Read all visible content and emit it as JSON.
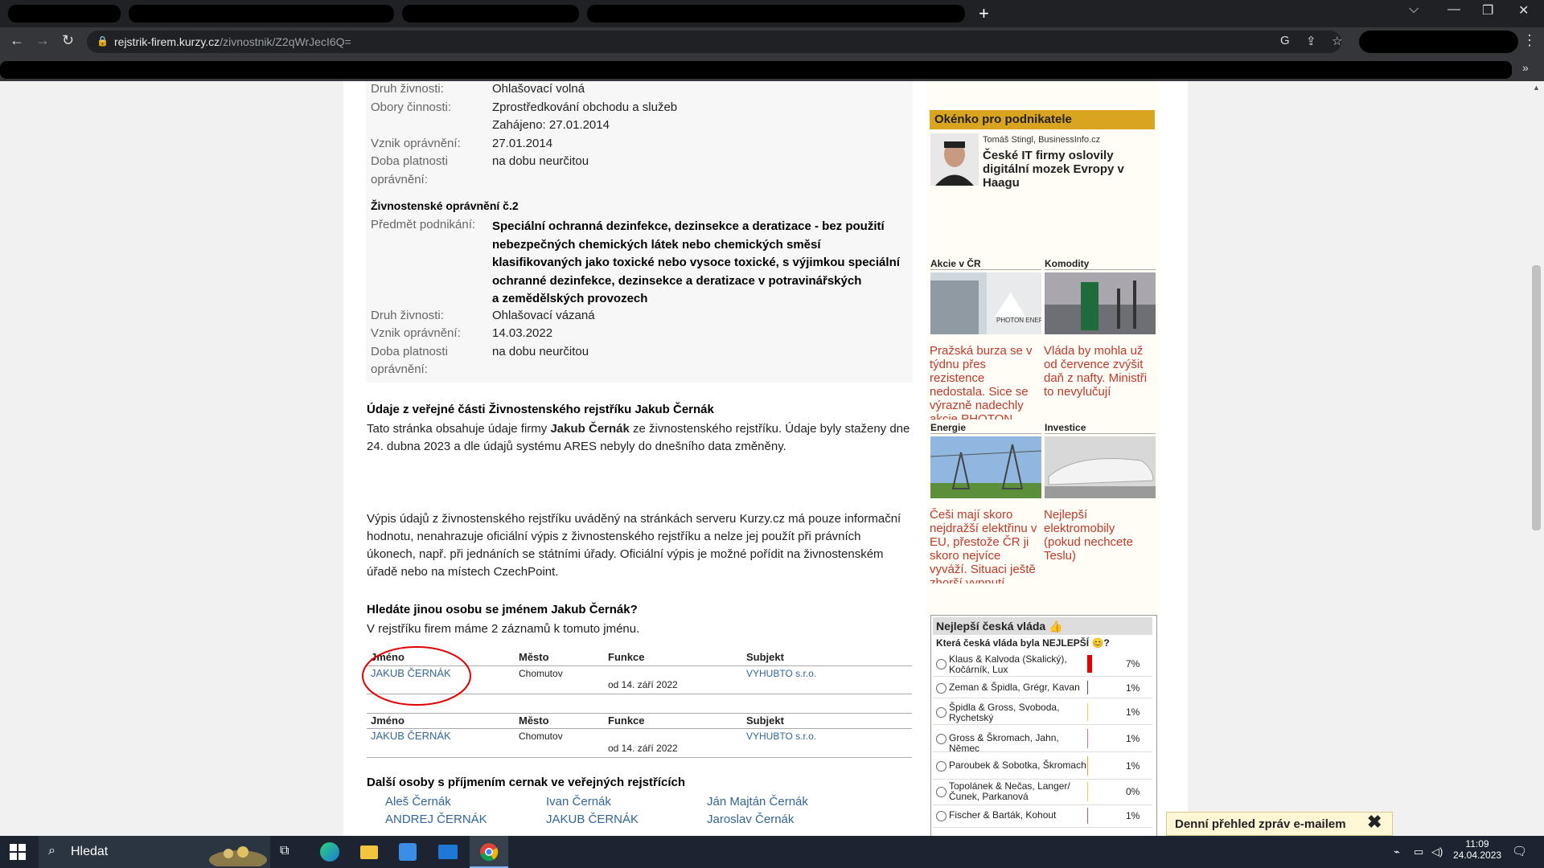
{
  "browser": {
    "url_domain": "rejstrik-firem.kurzy.cz",
    "url_path": "/zivnostnik/Z2qWrJecI6Q=",
    "new_tab_symbol": "+",
    "minimize": "⌵",
    "win_min": "—",
    "win_max": "❐",
    "win_close": "✕",
    "back": "←",
    "forward": "→",
    "reload": "↻",
    "menu": "⋮",
    "extensions": "»"
  },
  "permit1": {
    "druh_label": "Druh živnosti:",
    "druh_value": "Ohlašovací volná",
    "obory_label": "Obory činnosti:",
    "obory_value": "Zprostředkování obchodu a služeb",
    "zahajeno": "Zahájeno: 27.01.2014",
    "vznik_label": "Vznik oprávnění:",
    "vznik_value": "27.01.2014",
    "doba_label1": "Doba platnosti",
    "doba_label2": "oprávnění:",
    "doba_value": "na dobu neurčitou"
  },
  "permit2": {
    "title": "Živnostenské oprávnění č.2",
    "predmet_label": "Předmět podnikání:",
    "predmet_lines": [
      "Speciální ochranná dezinfekce, dezinsekce a deratizace - bez použití",
      "nebezpečných chemických látek nebo chemických směsí",
      "klasifikovaných jako toxické nebo vysoce toxické, s výjimkou speciální",
      "ochranné dezinfekce, dezinsekce a deratizace v potravinářských",
      "a zemědělských provozech"
    ],
    "druh_label": "Druh živnosti:",
    "druh_value": "Ohlašovací vázaná",
    "vznik_label": "Vznik oprávnění:",
    "vznik_value": "14.03.2022",
    "doba_label1": "Doba platnosti",
    "doba_label2": "oprávnění:",
    "doba_value": "na dobu neurčitou"
  },
  "public": {
    "title": "Údaje z veřejné části Živnostenského rejstříku Jakub Černák",
    "line1_pre": "Tato stránka obsahuje údaje firmy ",
    "line1_bold": "Jakub Černák",
    "line1_post": " ze živnostenského rejstříku. Údaje byly staženy dne",
    "line2": "24. dubna 2023 a dle údajů systému ARES nebyly do dnešního data změněny."
  },
  "disclaimer": [
    "Výpis údajů z živnostenského rejstříku uváděný na stránkách serveru Kurzy.cz má pouze informační",
    "hodnotu, nenahrazuje oficiální výpis z živnostenského rejstříku a nelze jej použít při právních",
    "úkonech, např. při jednáních se státními úřady. Oficiální výpis je možné pořídit na živnostenském",
    "úřadě nebo na místech CzechPoint."
  ],
  "search": {
    "title": "Hledáte jinou osobu se jménem Jakub Černák?",
    "subtitle": "V rejstříku firem máme 2 záznamů k tomuto jménu."
  },
  "table": {
    "headers": [
      "Jméno",
      "Město",
      "Funkce",
      "Subjekt"
    ],
    "rows": [
      {
        "name": "JAKUB ČERNÁK",
        "city": "Chomutov",
        "function": "od 14. září 2022",
        "subject": "VYHUBTO s.r.o."
      },
      {
        "name": "JAKUB ČERNÁK",
        "city": "Chomutov",
        "function": "od 14. září 2022",
        "subject": "VYHUBTO s.r.o."
      }
    ]
  },
  "others": {
    "title": "Další osoby s příjmením cernak ve veřejných rejstřících",
    "col1": [
      "Aleš Černák",
      "ANDREJ ČERNÁK"
    ],
    "col2": [
      "Ivan Černák",
      "JAKUB ČERNÁK"
    ],
    "col3": [
      "Ján Majtán Černák",
      "Jaroslav Černák"
    ]
  },
  "sidebar": {
    "okenko_title": "Okénko pro podnikatele",
    "author": "Tomáš Stingl, BusinessInfo.cz",
    "headline": [
      "České IT firmy oslovily",
      "digitální mozek Evropy v",
      "Haagu"
    ],
    "cats": [
      {
        "name": "Akcie v ČR",
        "text": [
          "Pražská burza se v",
          "týdnu přes",
          "rezistence",
          "nedostala. Sice se",
          "výrazně nadechly",
          "akcie PHOTON"
        ]
      },
      {
        "name": "Komodity",
        "text": [
          "Vláda by mohla už",
          "od července zvýšit",
          "daň z nafty. Ministři",
          "to nevylučují"
        ]
      },
      {
        "name": "Energie",
        "text": [
          "Češi mají skoro",
          "nejdražší elektřinu v",
          "EU, přestože ČR ji",
          "skoro nejvíce",
          "vyváží. Situaci ještě",
          "zhorší vypnutí"
        ]
      },
      {
        "name": "Investice",
        "text": [
          "Nejlepší",
          "elektromobily",
          "(pokud nechcete",
          "Teslu)"
        ]
      }
    ],
    "photon_label": "PHOTON ENERGY"
  },
  "poll": {
    "title": "Nejlepší česká vláda",
    "question": "Která česká vláda byla NEJLEPŠÍ",
    "options": [
      {
        "label": "Klaus & Kalvoda (Skalický), Kočárník, Lux",
        "pct": "7%",
        "color": "#e00000"
      },
      {
        "label": "Zeman & Špidla, Grégr, Kavan",
        "pct": "1%",
        "color": "#3355aa"
      },
      {
        "label": "Špidla & Gross, Svoboda, Rychetský",
        "pct": "1%",
        "color": "#f0d040"
      },
      {
        "label": "Gross & Škromach, Jahn, Němec",
        "pct": "1%",
        "color": "#cc66cc"
      },
      {
        "label": "Paroubek & Sobotka, Škromach",
        "pct": "1%",
        "color": "#f0a030"
      },
      {
        "label": "Topolánek & Nečas, Langer/ Čunek, Parkanová",
        "pct": "0%",
        "color": "#f0d040"
      },
      {
        "label": "Fischer & Barták, Kohout",
        "pct": "1%",
        "color": "#e05050"
      }
    ]
  },
  "banner": {
    "text": "Denní přehled zpráv e-mailem",
    "close": "✖"
  },
  "taskbar": {
    "search": "Hledat",
    "time": "11:09",
    "date": "24.04.2023"
  }
}
